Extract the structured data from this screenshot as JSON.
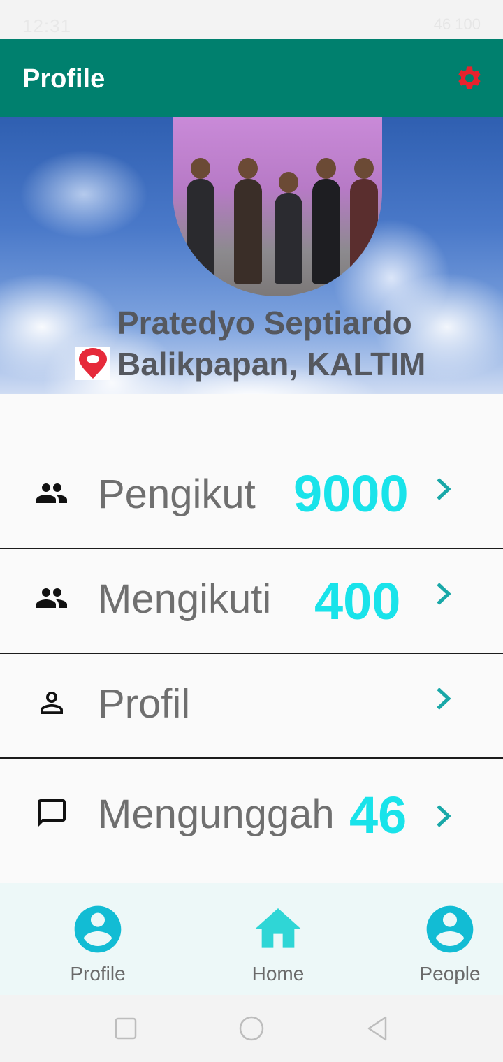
{
  "status_bar": {
    "time": "12:31",
    "right_text": "46  100"
  },
  "app_bar": {
    "title": "Profile",
    "settings_icon": "gear-icon",
    "settings_color": "#e8222d",
    "background": "#00806e"
  },
  "profile": {
    "name": "Pratedyo Septiardo",
    "location": "Balikpapan, KALTIM",
    "location_icon": "location-pin-icon"
  },
  "menu": {
    "items": [
      {
        "label": "Pengikut",
        "count": "9000",
        "icon": "people-icon"
      },
      {
        "label": "Mengikuti",
        "count": "400",
        "icon": "people-icon"
      },
      {
        "label": "Profil",
        "count": "",
        "icon": "person-outline-icon"
      },
      {
        "label": "Mengunggah",
        "count": "46",
        "icon": "chat-bubble-icon"
      }
    ],
    "accent": "#19e3ea",
    "chevron_color": "#19a8a8"
  },
  "bottom_nav": {
    "items": [
      {
        "label": "Profile",
        "icon": "account-circle-icon"
      },
      {
        "label": "Home",
        "icon": "home-icon"
      },
      {
        "label": "People",
        "icon": "account-circle-icon"
      }
    ],
    "icon_color": "#12bcd4",
    "home_color": "#2fd6d6"
  },
  "system_nav": {
    "buttons": [
      "recents-button",
      "home-button",
      "back-button"
    ]
  }
}
